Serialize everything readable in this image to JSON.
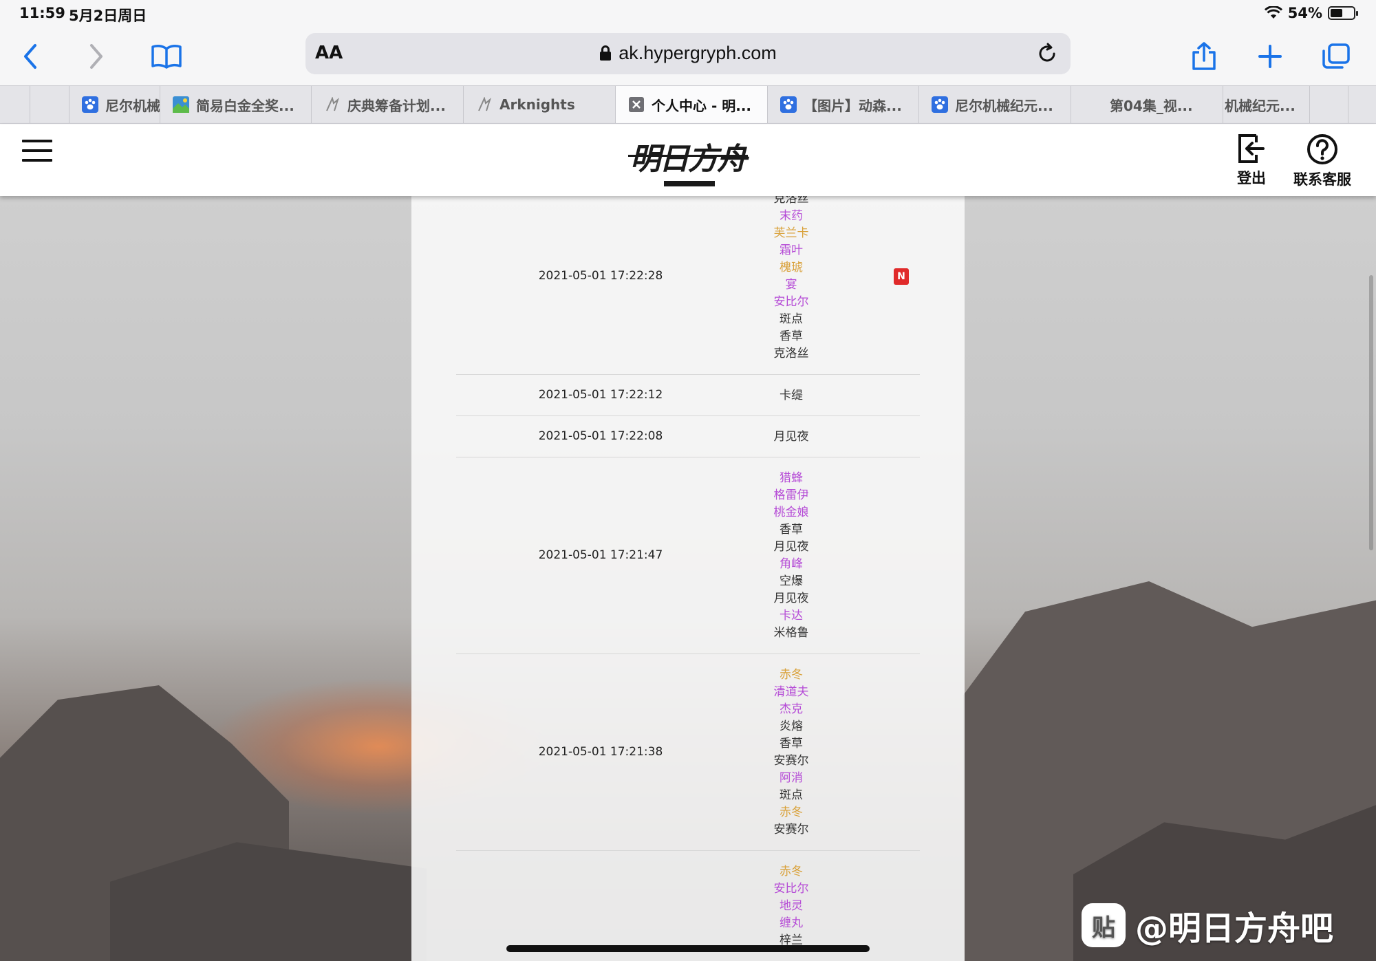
{
  "status": {
    "time": "11:59",
    "date": "5月2日周日",
    "battery": "54%",
    "battery_level": 0.54
  },
  "browser": {
    "aa_label": "AA",
    "url": "ak.hypergryph.com"
  },
  "tabs": [
    {
      "label": "尼尔机械",
      "favicon": "paw-icon",
      "active": false
    },
    {
      "label": "简易白金全奖...",
      "favicon": "image-icon",
      "active": false
    },
    {
      "label": "庆典筹备计划...",
      "favicon": "arknights-icon",
      "active": false
    },
    {
      "label": "Arknights",
      "favicon": "arknights-icon",
      "active": false
    },
    {
      "label": "个人中心 - 明...",
      "favicon": "close-icon",
      "active": true
    },
    {
      "label": "【图片】动森...",
      "favicon": "paw-icon",
      "active": false
    },
    {
      "label": "尼尔机械纪元...",
      "favicon": "paw-icon",
      "active": false
    },
    {
      "label": "第04集_视...",
      "favicon": "",
      "active": false
    },
    {
      "label": "机械纪元...",
      "favicon": "",
      "active": false
    }
  ],
  "site": {
    "logo_text": "明日方舟",
    "logout_label": "登出",
    "support_label": "联系客服"
  },
  "colors": {
    "rarity3": "#333333",
    "rarity4": "#b54bd6",
    "rarity5": "#d9a13a",
    "new_badge": "#e02a2a"
  },
  "records": [
    {
      "time": "2021-05-01 17:22:28",
      "badge": "N",
      "names": [
        {
          "name": "克洛丝",
          "rarity": 3
        },
        {
          "name": "末药",
          "rarity": 4
        },
        {
          "name": "芙兰卡",
          "rarity": 5
        },
        {
          "name": "霜叶",
          "rarity": 4
        },
        {
          "name": "槐琥",
          "rarity": 5
        },
        {
          "name": "宴",
          "rarity": 4
        },
        {
          "name": "安比尔",
          "rarity": 4
        },
        {
          "name": "斑点",
          "rarity": 3
        },
        {
          "name": "香草",
          "rarity": 3
        },
        {
          "name": "克洛丝",
          "rarity": 3
        }
      ]
    },
    {
      "time": "2021-05-01 17:22:12",
      "names": [
        {
          "name": "卡缇",
          "rarity": 3
        }
      ]
    },
    {
      "time": "2021-05-01 17:22:08",
      "names": [
        {
          "name": "月见夜",
          "rarity": 3
        }
      ]
    },
    {
      "time": "2021-05-01 17:21:47",
      "names": [
        {
          "name": "猎蜂",
          "rarity": 4
        },
        {
          "name": "格雷伊",
          "rarity": 4
        },
        {
          "name": "桃金娘",
          "rarity": 4
        },
        {
          "name": "香草",
          "rarity": 3
        },
        {
          "name": "月见夜",
          "rarity": 3
        },
        {
          "name": "角峰",
          "rarity": 4
        },
        {
          "name": "空爆",
          "rarity": 3
        },
        {
          "name": "月见夜",
          "rarity": 3
        },
        {
          "name": "卡达",
          "rarity": 4
        },
        {
          "name": "米格鲁",
          "rarity": 3
        }
      ]
    },
    {
      "time": "2021-05-01 17:21:38",
      "names": [
        {
          "name": "赤冬",
          "rarity": 5
        },
        {
          "name": "清道夫",
          "rarity": 4
        },
        {
          "name": "杰克",
          "rarity": 4
        },
        {
          "name": "炎熔",
          "rarity": 3
        },
        {
          "name": "香草",
          "rarity": 3
        },
        {
          "name": "安赛尔",
          "rarity": 3
        },
        {
          "name": "阿消",
          "rarity": 4
        },
        {
          "name": "斑点",
          "rarity": 3
        },
        {
          "name": "赤冬",
          "rarity": 5
        },
        {
          "name": "安赛尔",
          "rarity": 3
        }
      ]
    },
    {
      "time": "",
      "names": [
        {
          "name": "赤冬",
          "rarity": 5
        },
        {
          "name": "安比尔",
          "rarity": 4
        },
        {
          "name": "地灵",
          "rarity": 4
        },
        {
          "name": "缠丸",
          "rarity": 4
        },
        {
          "name": "梓兰",
          "rarity": 3
        }
      ]
    }
  ],
  "watermark": {
    "logo_char": "贴",
    "text": "@明日方舟吧"
  }
}
